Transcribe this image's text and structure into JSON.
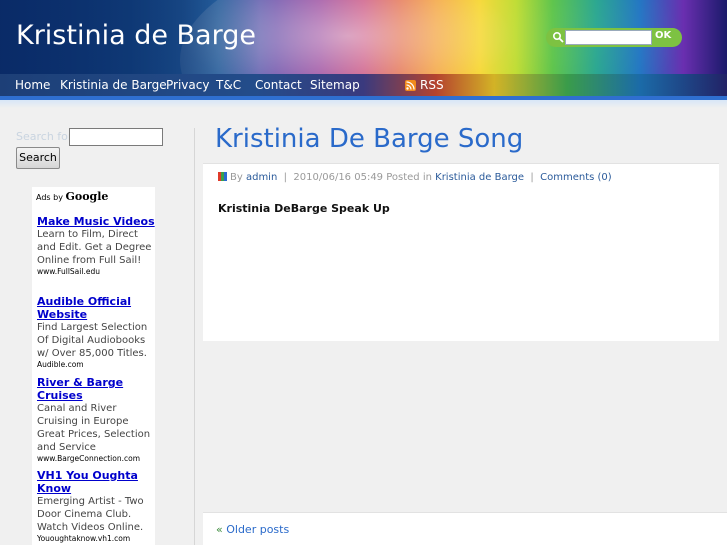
{
  "header": {
    "site_title": "Kristinia de Barge",
    "search_button": "OK",
    "search_value": ""
  },
  "nav": {
    "items": [
      "Home",
      "Kristinia de Barge",
      "Privacy",
      "T&C",
      "Contact",
      "Sitemap"
    ],
    "rss": "RSS"
  },
  "sidebar": {
    "search_label": "Search for:",
    "search_value": "",
    "search_button": "Search",
    "ads_by": "Ads by",
    "ads_brand": "Google",
    "ads": [
      {
        "title": "Make Music Videos",
        "desc": "Learn to Film, Direct and Edit. Get a Degree Online from Full Sail!",
        "url": "www.FullSail.edu"
      },
      {
        "title": "Audible Official Website",
        "desc": "Find Largest Selection Of Digital Audiobooks w/ Over 85,000 Titles.",
        "url": "Audible.com"
      },
      {
        "title": "River & Barge Cruises",
        "desc": "Canal and River Cruising in Europe Great Prices, Selection and Service",
        "url": "www.BargeConnection.com"
      },
      {
        "title": "VH1 You Oughta Know",
        "desc": "Emerging Artist - Two Door Cinema Club. Watch Videos Online.",
        "url": "Yououghtaknow.vh1.com"
      }
    ]
  },
  "post": {
    "title": "Kristinia De Barge Song",
    "meta_by": "By",
    "author": "admin",
    "date": "2010/06/16 05:49",
    "posted_in": "Posted in",
    "category": "Kristinia de Barge",
    "comments": "Comments (0)",
    "body": "Kristinia DeBarge Speak Up"
  },
  "pagination": {
    "older_arrow": "«",
    "older_label": "Older posts"
  }
}
